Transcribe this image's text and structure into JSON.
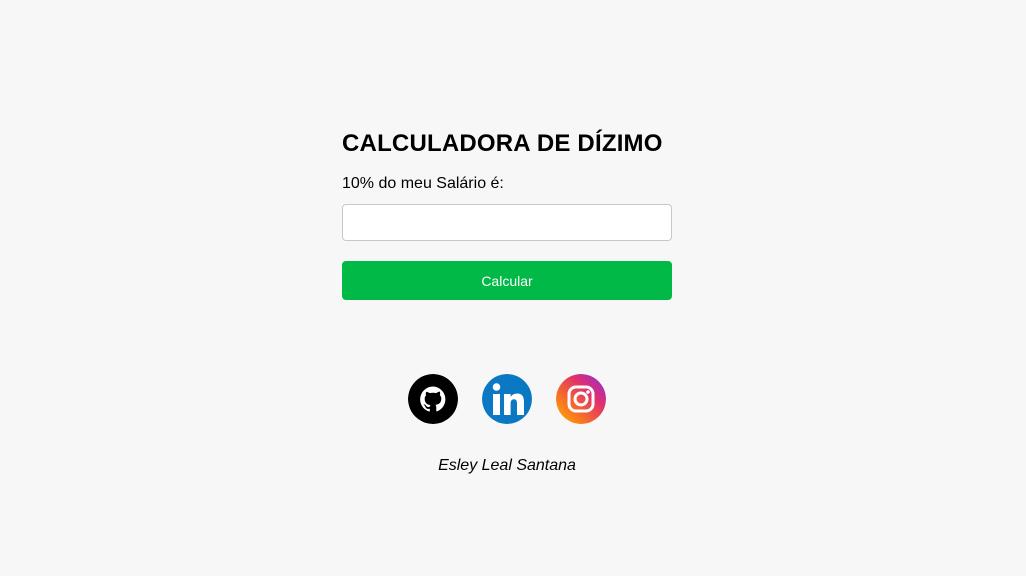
{
  "calculator": {
    "title": "CALCULADORA DE DÍZIMO",
    "label": "10% do meu Salário é:",
    "input_value": "",
    "input_placeholder": "",
    "button_label": "Calcular"
  },
  "social": {
    "links": [
      {
        "name": "github",
        "icon": "github-icon"
      },
      {
        "name": "linkedin",
        "icon": "linkedin-icon"
      },
      {
        "name": "instagram",
        "icon": "instagram-icon"
      }
    ]
  },
  "footer": {
    "author": "Esley Leal Santana"
  },
  "colors": {
    "background": "#f7f7f7",
    "button": "#00b947",
    "github": "#000000",
    "linkedin": "#0a78c2"
  }
}
